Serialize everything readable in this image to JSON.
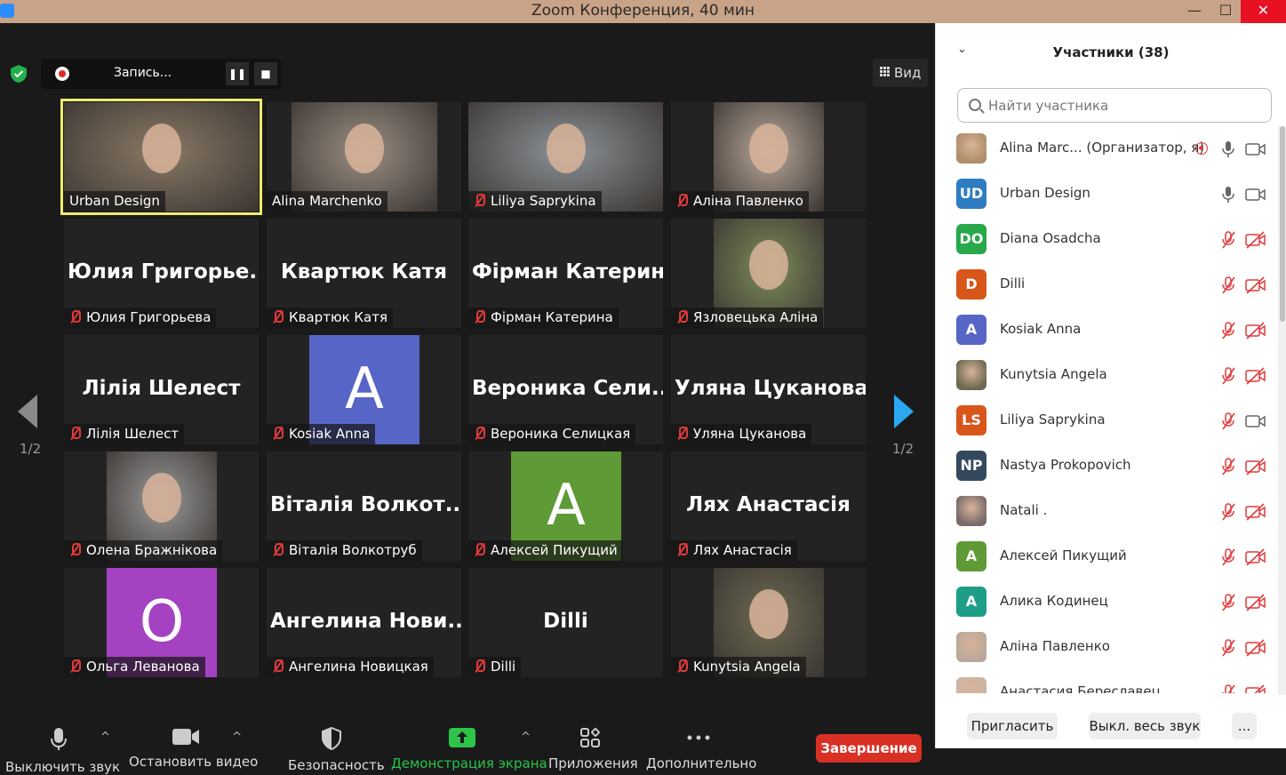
{
  "window": {
    "title": "Zoom Конференция, 40 мин",
    "minimize": "—",
    "maximize": "☐",
    "close": "✕"
  },
  "recording": {
    "label": "Запись...",
    "pause_icon": "❚❚",
    "stop_icon": "■"
  },
  "view_button": {
    "label": "Вид"
  },
  "pagination": {
    "left": "1/2",
    "right": "1/2"
  },
  "tiles": [
    {
      "name": "Urban Design",
      "muted": false,
      "active": true,
      "kind": "photo",
      "bg": "#8a7a66"
    },
    {
      "name": "Alina Marchenko",
      "muted": false,
      "kind": "photo",
      "bg": "#9b8f84"
    },
    {
      "name": "Liliya Saprykina",
      "muted": true,
      "kind": "photo",
      "bg": "#8c9297"
    },
    {
      "name": "Аліна Павленко",
      "muted": true,
      "kind": "photo",
      "bg": "#b9a89a"
    },
    {
      "name": "Юлия Григорьева",
      "muted": true,
      "kind": "text",
      "big": "Юлия Григорье..."
    },
    {
      "name": "Квартюк Катя",
      "muted": true,
      "kind": "text",
      "big": "Квартюк Катя"
    },
    {
      "name": "Фірман Катерина",
      "muted": true,
      "kind": "text",
      "big": "Фірман Катерина"
    },
    {
      "name": "Язловецька Аліна",
      "muted": true,
      "kind": "photo",
      "bg": "#7d8c5a"
    },
    {
      "name": "Лілія Шелест",
      "muted": true,
      "kind": "text",
      "big": "Лілія Шелест"
    },
    {
      "name": "Kosiak Anna",
      "muted": true,
      "kind": "letter",
      "letter": "A",
      "color": "#5765c6"
    },
    {
      "name": "Вероника Селицкая",
      "muted": true,
      "kind": "text",
      "big": "Вероника Сели..."
    },
    {
      "name": "Уляна Цуканова",
      "muted": true,
      "kind": "text",
      "big": "Уляна Цуканова"
    },
    {
      "name": "Олена Бражнікова",
      "muted": true,
      "kind": "photo",
      "bg": "#9a9a9a"
    },
    {
      "name": "Віталія Волкотруб",
      "muted": true,
      "kind": "text",
      "big": "Віталія Волкот..."
    },
    {
      "name": "Алексей Пикущий",
      "muted": true,
      "kind": "letter",
      "letter": "A",
      "color": "#5e9a35"
    },
    {
      "name": "Лях Анастасія",
      "muted": true,
      "kind": "text",
      "big": "Лях Анастасія"
    },
    {
      "name": "Ольга Леванова",
      "muted": true,
      "kind": "letter",
      "letter": "O",
      "color": "#a442c2"
    },
    {
      "name": "Ангелина Новицкая",
      "muted": true,
      "kind": "text",
      "big": "Ангелина Нови..."
    },
    {
      "name": "Dilli",
      "muted": true,
      "kind": "text",
      "big": "Dilli"
    },
    {
      "name": "Kunytsia Angela",
      "muted": true,
      "kind": "photo",
      "bg": "#6e6a52"
    }
  ],
  "toolbar": {
    "mute": "Выключить звук",
    "stop_video": "Остановить видео",
    "security": "Безопасность",
    "share_screen": "Демонстрация экрана",
    "apps": "Приложения",
    "more": "Дополнительно",
    "end": "Завершение",
    "caret": "^"
  },
  "panel": {
    "collapse_icon": "⌄",
    "title": "Участники (38)",
    "search_placeholder": "Найти участника",
    "invite": "Пригласить",
    "mute_all": "Выкл. весь звук",
    "more": "..."
  },
  "participants": [
    {
      "name": "Alina Marc...  (Организатор, я)",
      "avatar": "",
      "color": "#b08e6a",
      "photo": true,
      "mic": "on",
      "cam": "on",
      "rec": true
    },
    {
      "name": "Urban Design",
      "avatar": "UD",
      "color": "#2e7cc2",
      "mic": "on",
      "cam": "on"
    },
    {
      "name": "Diana Osadcha",
      "avatar": "DO",
      "color": "#27a84a",
      "mic": "off",
      "cam": "off"
    },
    {
      "name": "Dilli",
      "avatar": "D",
      "color": "#d8561a",
      "mic": "off",
      "cam": "off"
    },
    {
      "name": "Kosiak Anna",
      "avatar": "A",
      "color": "#5765c6",
      "mic": "off",
      "cam": "off"
    },
    {
      "name": "Kunytsia Angela",
      "avatar": "",
      "color": "#6e6a52",
      "photo": true,
      "mic": "off",
      "cam": "off"
    },
    {
      "name": "Liliya Saprykina",
      "avatar": "LS",
      "color": "#d8561a",
      "mic": "off",
      "cam": "on"
    },
    {
      "name": "Nastya Prokopovich",
      "avatar": "NP",
      "color": "#34495e",
      "mic": "off",
      "cam": "off"
    },
    {
      "name": "Natali .",
      "avatar": "",
      "color": "#7a6a6a",
      "photo": true,
      "mic": "off",
      "cam": "off"
    },
    {
      "name": "Алексей Пикущий",
      "avatar": "A",
      "color": "#5e9a35",
      "mic": "off",
      "cam": "off"
    },
    {
      "name": "Алика Кодинец",
      "avatar": "A",
      "color": "#1e9e87",
      "mic": "off",
      "cam": "off"
    },
    {
      "name": "Аліна Павленко",
      "avatar": "",
      "color": "#b9a89a",
      "photo": true,
      "mic": "off",
      "cam": "off"
    },
    {
      "name": "Анастасия Береславец",
      "avatar": "",
      "color": "#c9b5a5",
      "photo": true,
      "mic": "off",
      "cam": "off"
    }
  ]
}
